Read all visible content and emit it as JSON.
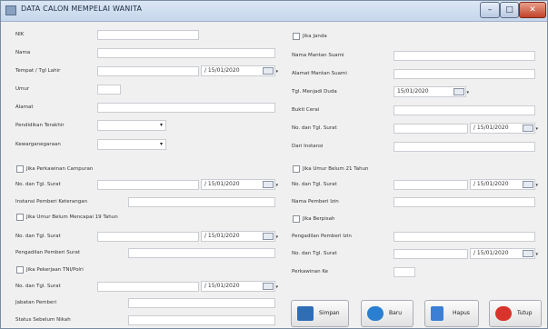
{
  "window": {
    "title": "DATA CALON MEMPELAI WANITA"
  },
  "left": {
    "nik": "NIK",
    "nama": "Nama",
    "ttl": "Tempat / Tgl Lahir",
    "umur": "Umur",
    "alamat": "Alamat",
    "pendidikan": "Pendidikan Terakhir",
    "kewarganegaraan": "Kewarganegaraan",
    "jika_perkawinan_campuran": "Jika Perkawinan Campuran",
    "no_tgl_surat_1": "No. dan Tgl. Surat",
    "instansi_pemberi_keterangan": "Instansi Pemberi Keterangan",
    "jika_umur_belum_19": "Jika Umur Belum Mencapai 19 Tahun",
    "no_tgl_surat_2": "No. dan Tgl. Surat",
    "pengadilan_pemberi_surat": "Pengadilan Pemberi Surat",
    "jika_pekerjaan_tni": "Jika Pekerjaan TNI/Polri",
    "no_tgl_surat_3": "No. dan Tgl. Surat",
    "jabatan_pemberi": "Jabatan Pemberi",
    "status_sebelum_nikah": "Status Sebelum Nikah"
  },
  "right": {
    "jika_janda": "Jika Janda",
    "nama_mantan_suami": "Nama Mantan Suami",
    "alamat_mantan_suami": "Alamat Mantan Suami",
    "tgl_menjadi_duda": "Tgl. Menjadi Duda",
    "bukti_cerai": "Bukti Cerai",
    "no_tgl_surat_4": "No. dan Tgl. Surat",
    "dari_instansi": "Dari Instansi",
    "jika_umur_belum_21": "Jika Umur Belum 21 Tahun",
    "no_tgl_surat_5": "No. dan Tgl. Surat",
    "nama_pemberi_izin": "Nama Pemberi Izin",
    "jika_berpisah": "Jika Berpisah",
    "pengadilan_pemberi_izin": "Pengadilan Pemberi Izin",
    "no_tgl_surat_6": "No. dan Tgl. Surat",
    "perkawinan_ke": "Perkawinan Ke"
  },
  "dates": {
    "ttl": "/ 15/01/2020",
    "surat1": "/ 15/01/2020",
    "surat2": "/ 15/01/2020",
    "surat3": "/ 15/01/2020",
    "duda": "15/01/2020",
    "surat4": "/ 15/01/2020",
    "surat5": "/ 15/01/2020",
    "surat6": "/ 15/01/2020"
  },
  "buttons": {
    "simpan": "Simpan",
    "baru": "Baru",
    "hapus": "Hapus",
    "tutup": "Tutup"
  },
  "colors": {
    "simpan_icon": "#2f6db5",
    "baru_icon": "#2a7fd0",
    "hapus_icon": "#3b7fd6",
    "tutup_icon": "#d8342c"
  }
}
